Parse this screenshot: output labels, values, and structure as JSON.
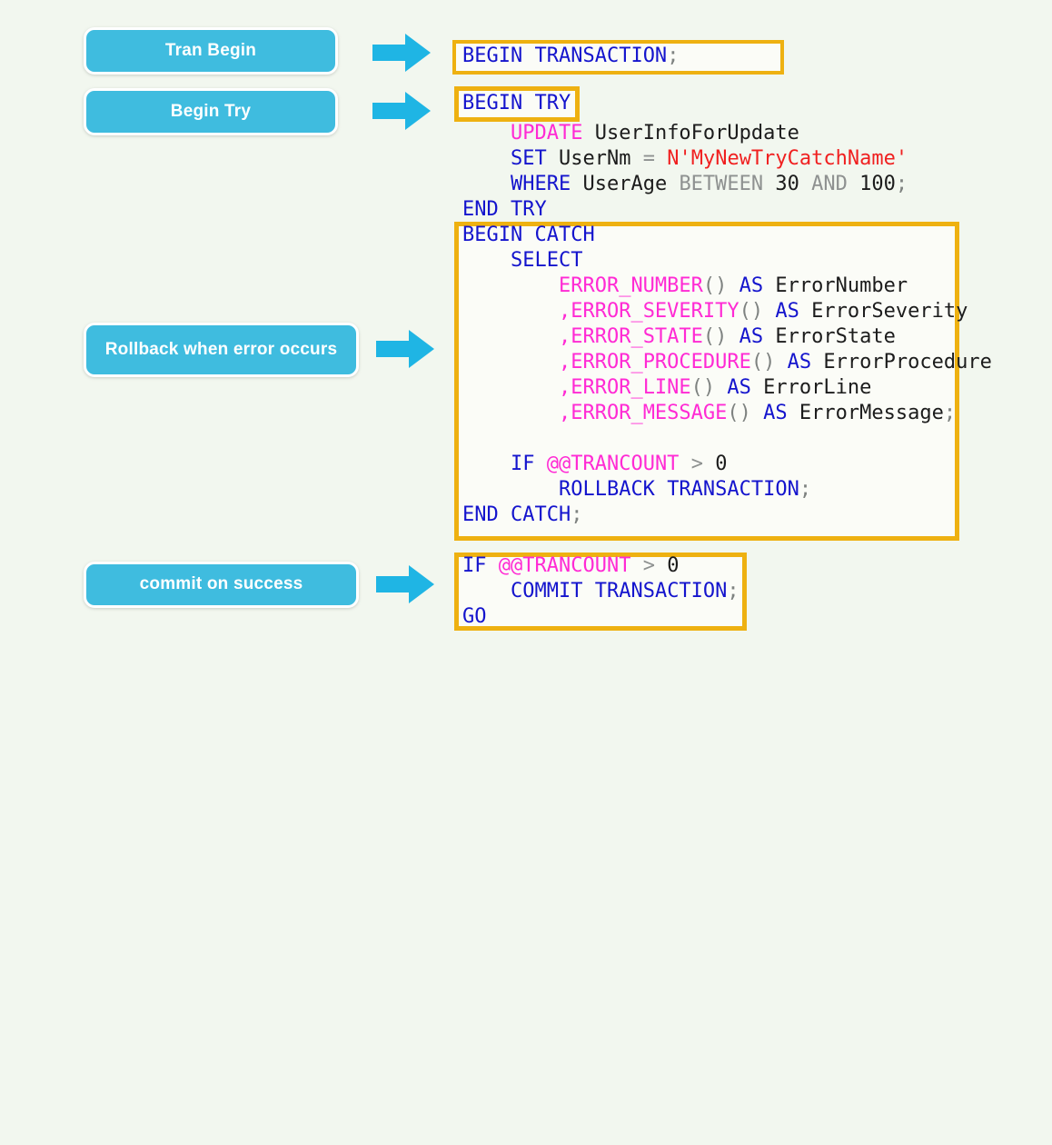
{
  "page": {
    "title": "SQL Server TRY CATCH transaction template",
    "background_color": "#f2f7ef",
    "highlight_border_color": "#eeb111",
    "button_color": "#3fbcdf",
    "arrow_color": "#1fb5e4"
  },
  "labels": [
    {
      "id": "tran-begin",
      "text": "Tran Begin"
    },
    {
      "id": "begin-try",
      "text": "Begin Try"
    },
    {
      "id": "rollback",
      "text": "Rollback when error occurs"
    },
    {
      "id": "commit",
      "text": "commit on success"
    }
  ],
  "code_lines": [
    {
      "id": "l1",
      "text": "BEGIN TRANSACTION;"
    },
    {
      "id": "l2",
      "text": "BEGIN TRY"
    },
    {
      "id": "l3",
      "text": "    UPDATE UserInfoForUpdate"
    },
    {
      "id": "l4",
      "text": "    SET UserNm = N'MyNewTryCatchName'"
    },
    {
      "id": "l5",
      "text": "    WHERE UserAge BETWEEN 30 AND 100;"
    },
    {
      "id": "l6",
      "text": "END TRY"
    },
    {
      "id": "l7",
      "text": "BEGIN CATCH"
    },
    {
      "id": "l8",
      "text": "    SELECT"
    },
    {
      "id": "l9",
      "text": "        ERROR_NUMBER() AS ErrorNumber"
    },
    {
      "id": "l10",
      "text": "        ,ERROR_SEVERITY() AS ErrorSeverity"
    },
    {
      "id": "l11",
      "text": "        ,ERROR_STATE() AS ErrorState"
    },
    {
      "id": "l12",
      "text": "        ,ERROR_PROCEDURE() AS ErrorProcedure"
    },
    {
      "id": "l13",
      "text": "        ,ERROR_LINE() AS ErrorLine"
    },
    {
      "id": "l14",
      "text": "        ,ERROR_MESSAGE() AS ErrorMessage;"
    },
    {
      "id": "l15",
      "text": ""
    },
    {
      "id": "l16",
      "text": "    IF @@TRANCOUNT > 0"
    },
    {
      "id": "l17",
      "text": "        ROLLBACK TRANSACTION;"
    },
    {
      "id": "l18",
      "text": "END CATCH;"
    },
    {
      "id": "l19",
      "text": "IF @@TRANCOUNT > 0"
    },
    {
      "id": "l20",
      "text": "    COMMIT TRANSACTION;"
    },
    {
      "id": "l21",
      "text": "GO"
    }
  ],
  "highlight_boxes": [
    {
      "id": "box-begin-transaction",
      "covers": "BEGIN TRANSACTION;"
    },
    {
      "id": "box-begin-try",
      "covers": "BEGIN TRY"
    },
    {
      "id": "box-catch-block",
      "covers": "BEGIN CATCH ... END CATCH;"
    },
    {
      "id": "box-commit-block",
      "covers": "IF @@TRANCOUNT > 0 COMMIT TRANSACTION; GO"
    }
  ],
  "arrows": [
    {
      "id": "arrow-tran-begin"
    },
    {
      "id": "arrow-begin-try"
    },
    {
      "id": "arrow-rollback"
    },
    {
      "id": "arrow-commit"
    }
  ]
}
